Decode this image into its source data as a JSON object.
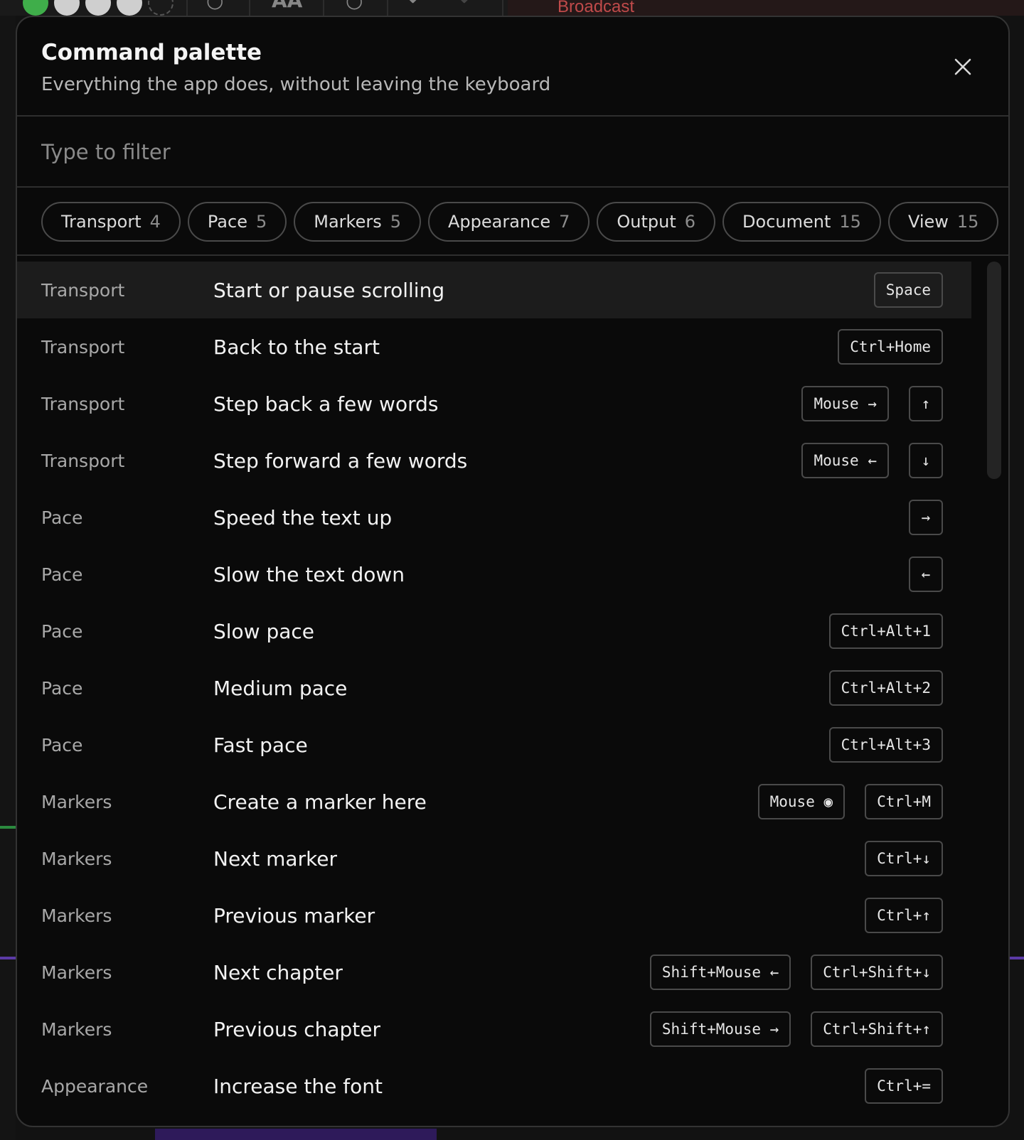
{
  "background": {
    "broadcast_tab": "Broadcast"
  },
  "modal": {
    "title": "Command palette",
    "subtitle": "Everything the app does, without leaving the keyboard",
    "filter_placeholder": "Type to filter"
  },
  "chips": [
    {
      "label": "Transport",
      "count": "4"
    },
    {
      "label": "Pace",
      "count": "5"
    },
    {
      "label": "Markers",
      "count": "5"
    },
    {
      "label": "Appearance",
      "count": "7"
    },
    {
      "label": "Output",
      "count": "6"
    },
    {
      "label": "Document",
      "count": "15"
    },
    {
      "label": "View",
      "count": "15"
    }
  ],
  "commands": [
    {
      "category": "Transport",
      "label": "Start or pause scrolling",
      "keys": [
        "Space"
      ],
      "active": true
    },
    {
      "category": "Transport",
      "label": "Back to the start",
      "keys": [
        "Ctrl+Home"
      ]
    },
    {
      "category": "Transport",
      "label": "Step back a few words",
      "keys": [
        "Mouse →",
        "↑"
      ]
    },
    {
      "category": "Transport",
      "label": "Step forward a few words",
      "keys": [
        "Mouse ←",
        "↓"
      ]
    },
    {
      "category": "Pace",
      "label": "Speed the text up",
      "keys": [
        "→"
      ]
    },
    {
      "category": "Pace",
      "label": "Slow the text down",
      "keys": [
        "←"
      ]
    },
    {
      "category": "Pace",
      "label": "Slow pace",
      "keys": [
        "Ctrl+Alt+1"
      ]
    },
    {
      "category": "Pace",
      "label": "Medium pace",
      "keys": [
        "Ctrl+Alt+2"
      ]
    },
    {
      "category": "Pace",
      "label": "Fast pace",
      "keys": [
        "Ctrl+Alt+3"
      ]
    },
    {
      "category": "Markers",
      "label": "Create a marker here",
      "keys": [
        "Mouse ◉",
        "Ctrl+M"
      ]
    },
    {
      "category": "Markers",
      "label": "Next marker",
      "keys": [
        "Ctrl+↓"
      ]
    },
    {
      "category": "Markers",
      "label": "Previous marker",
      "keys": [
        "Ctrl+↑"
      ]
    },
    {
      "category": "Markers",
      "label": "Next chapter",
      "keys": [
        "Shift+Mouse ←",
        "Ctrl+Shift+↓"
      ]
    },
    {
      "category": "Markers",
      "label": "Previous chapter",
      "keys": [
        "Shift+Mouse →",
        "Ctrl+Shift+↑"
      ]
    },
    {
      "category": "Appearance",
      "label": "Increase the font",
      "keys": [
        "Ctrl+="
      ]
    }
  ]
}
